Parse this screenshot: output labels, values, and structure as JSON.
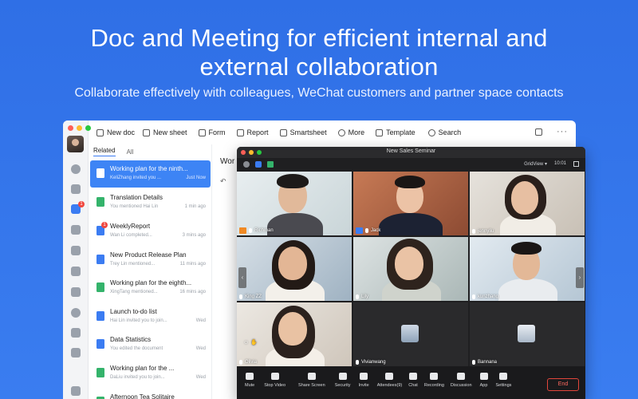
{
  "hero": {
    "title_line1": "Doc and Meeting for efficient internal and",
    "title_line2": "external collaboration",
    "subtitle": "Collaborate effectively with colleagues, WeChat customers and partner space contacts"
  },
  "toolbar": {
    "new_doc": "New doc",
    "new_sheet": "New sheet",
    "form": "Form",
    "report": "Report",
    "smartsheet": "Smartsheet",
    "more": "More",
    "template": "Template",
    "search": "Search"
  },
  "rail": {
    "badge_docs": "1"
  },
  "list": {
    "tabs": [
      "Related",
      "All"
    ],
    "items": [
      {
        "title": "Working plan for the ninth...",
        "meta": "KeliZhang invited you ...",
        "time": "Just Now",
        "icon": "doc-blue"
      },
      {
        "title": "Translation Details",
        "meta": "You mentioned Hai Lin",
        "time": "1 min ago",
        "icon": "sheet-green"
      },
      {
        "title": "WeeklyReport",
        "meta": "Wan Li completed...",
        "time": "3 mins ago",
        "icon": "doc-blue",
        "badge": "1"
      },
      {
        "title": "New Product Release Plan",
        "meta": "Trey Lin mentioned...",
        "time": "11 mins ago",
        "icon": "doc-blue"
      },
      {
        "title": "Working plan for the eighth...",
        "meta": "XingTang mentioned...",
        "time": "16 mins ago",
        "icon": "sheet-green"
      },
      {
        "title": "Launch to-do list",
        "meta": "Hai Lin invited you to join...",
        "time": "Wed",
        "icon": "doc-blue"
      },
      {
        "title": "Data Statistics",
        "meta": "You edited the document",
        "time": "Wed",
        "icon": "doc-blue"
      },
      {
        "title": "Working plan for the ...",
        "meta": "DaLiu invited you to join...",
        "time": "Wed",
        "icon": "sheet-green"
      },
      {
        "title": "Afternoon Tea Solitaire",
        "meta": "",
        "time": "",
        "icon": "sheet-green"
      }
    ]
  },
  "editor": {
    "title_partial": "Wor"
  },
  "meeting": {
    "title": "New Sales Seminar",
    "view_label": "GridView",
    "time": "10:01",
    "participants": [
      {
        "name": "Richman",
        "host": true
      },
      {
        "name": "Jack",
        "host": true
      },
      {
        "name": "jennyliu",
        "host": false
      },
      {
        "name": "King ZZ",
        "host": false
      },
      {
        "name": "Lily",
        "host": false
      },
      {
        "name": "kunzhang",
        "host": false
      },
      {
        "name": "Olivia",
        "host": false
      },
      {
        "name": "Vivianwang",
        "host": false
      },
      {
        "name": "Bannana",
        "host": false
      }
    ],
    "controls": [
      "Mute",
      "Stop Video",
      "Share Screen",
      "Security",
      "Invite",
      "Attendees(9)",
      "Chat",
      "Recording",
      "Discussion",
      "App",
      "Settings"
    ],
    "end_label": "End"
  },
  "colors": {
    "background": "#3a7df0",
    "accent": "#3b7cf2",
    "green_sheet": "#34b36b",
    "end_red": "#e2463b"
  }
}
